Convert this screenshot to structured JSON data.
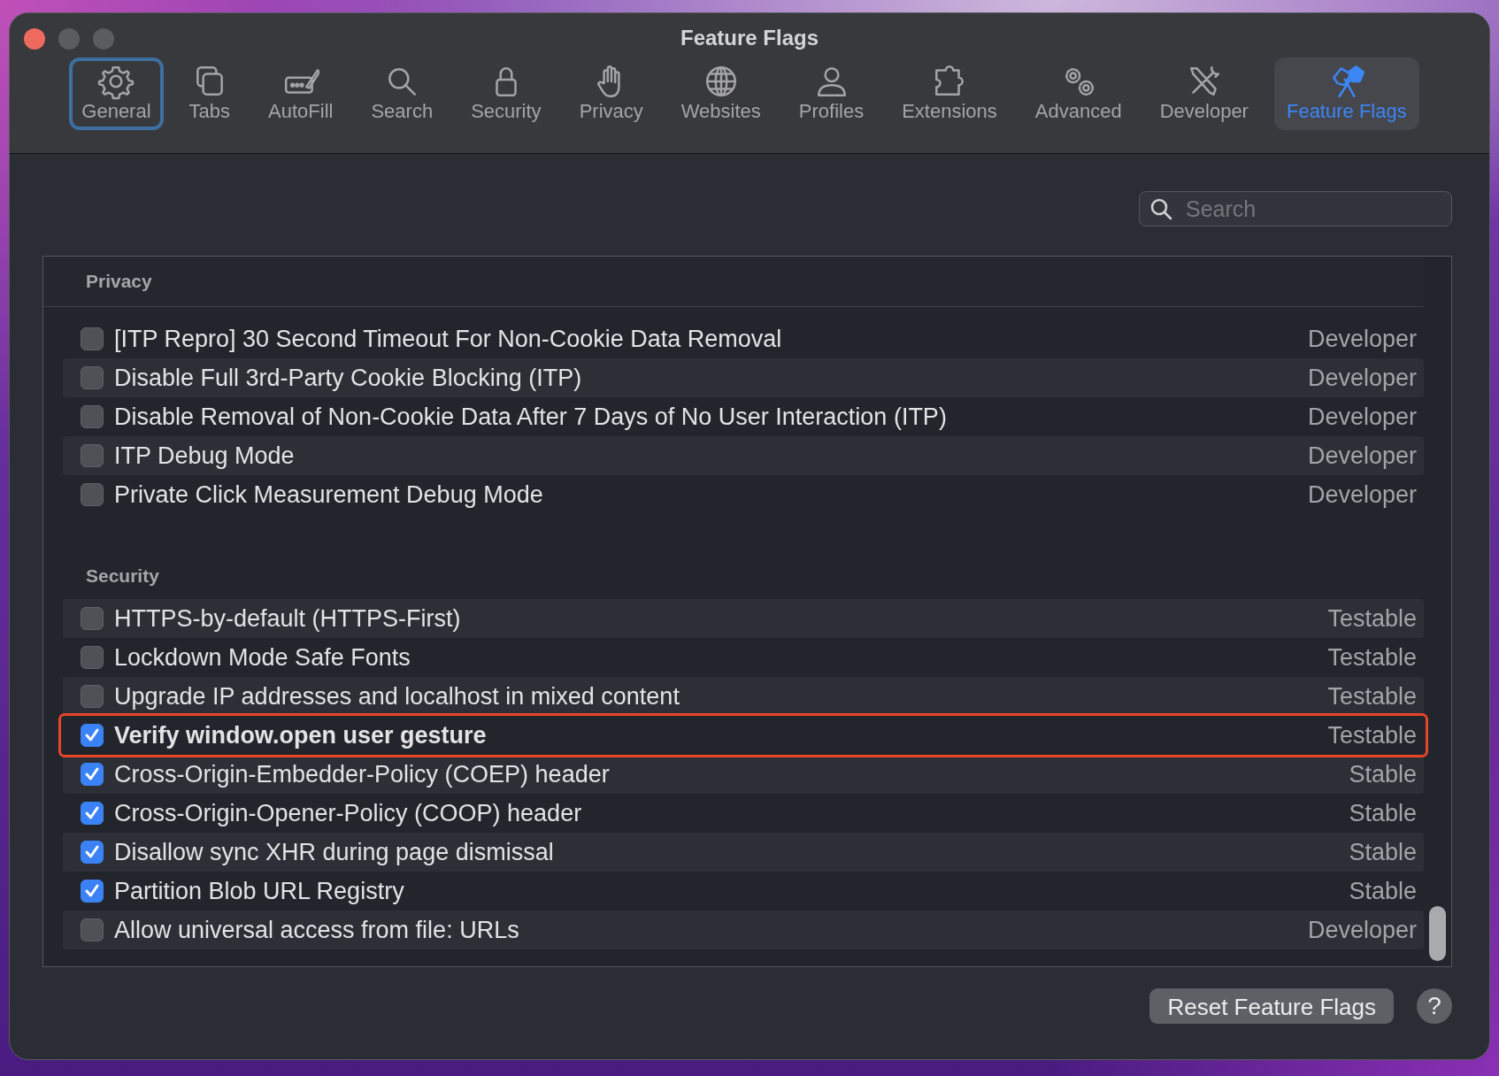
{
  "window": {
    "title": "Feature Flags"
  },
  "tabs": [
    {
      "label": "General",
      "selected": false,
      "focused": true
    },
    {
      "label": "Tabs",
      "selected": false,
      "focused": false
    },
    {
      "label": "AutoFill",
      "selected": false,
      "focused": false
    },
    {
      "label": "Search",
      "selected": false,
      "focused": false
    },
    {
      "label": "Security",
      "selected": false,
      "focused": false
    },
    {
      "label": "Privacy",
      "selected": false,
      "focused": false
    },
    {
      "label": "Websites",
      "selected": false,
      "focused": false
    },
    {
      "label": "Profiles",
      "selected": false,
      "focused": false
    },
    {
      "label": "Extensions",
      "selected": false,
      "focused": false
    },
    {
      "label": "Advanced",
      "selected": false,
      "focused": false
    },
    {
      "label": "Developer",
      "selected": false,
      "focused": false
    },
    {
      "label": "Feature Flags",
      "selected": true,
      "focused": false
    }
  ],
  "search": {
    "placeholder": "Search"
  },
  "sections": [
    {
      "title": "Privacy",
      "flags": [
        {
          "label": "[ITP Repro] 30 Second Timeout For Non-Cookie Data Removal",
          "status": "Developer",
          "checked": false,
          "highlighted": false
        },
        {
          "label": "Disable Full 3rd-Party Cookie Blocking (ITP)",
          "status": "Developer",
          "checked": false,
          "highlighted": false
        },
        {
          "label": "Disable Removal of Non-Cookie Data After 7 Days of No User Interaction (ITP)",
          "status": "Developer",
          "checked": false,
          "highlighted": false
        },
        {
          "label": "ITP Debug Mode",
          "status": "Developer",
          "checked": false,
          "highlighted": false
        },
        {
          "label": "Private Click Measurement Debug Mode",
          "status": "Developer",
          "checked": false,
          "highlighted": false
        }
      ]
    },
    {
      "title": "Security",
      "flags": [
        {
          "label": "HTTPS-by-default (HTTPS-First)",
          "status": "Testable",
          "checked": false,
          "highlighted": false
        },
        {
          "label": "Lockdown Mode Safe Fonts",
          "status": "Testable",
          "checked": false,
          "highlighted": false
        },
        {
          "label": "Upgrade IP addresses and localhost in mixed content",
          "status": "Testable",
          "checked": false,
          "highlighted": false
        },
        {
          "label": "Verify window.open user gesture",
          "status": "Testable",
          "checked": true,
          "highlighted": true
        },
        {
          "label": "Cross-Origin-Embedder-Policy (COEP) header",
          "status": "Stable",
          "checked": true,
          "highlighted": false
        },
        {
          "label": "Cross-Origin-Opener-Policy (COOP) header",
          "status": "Stable",
          "checked": true,
          "highlighted": false
        },
        {
          "label": "Disallow sync XHR during page dismissal",
          "status": "Stable",
          "checked": true,
          "highlighted": false
        },
        {
          "label": "Partition Blob URL Registry",
          "status": "Stable",
          "checked": true,
          "highlighted": false
        },
        {
          "label": "Allow universal access from file: URLs",
          "status": "Developer",
          "checked": false,
          "highlighted": false
        }
      ]
    }
  ],
  "buttons": {
    "reset": "Reset Feature Flags",
    "help": "?"
  }
}
